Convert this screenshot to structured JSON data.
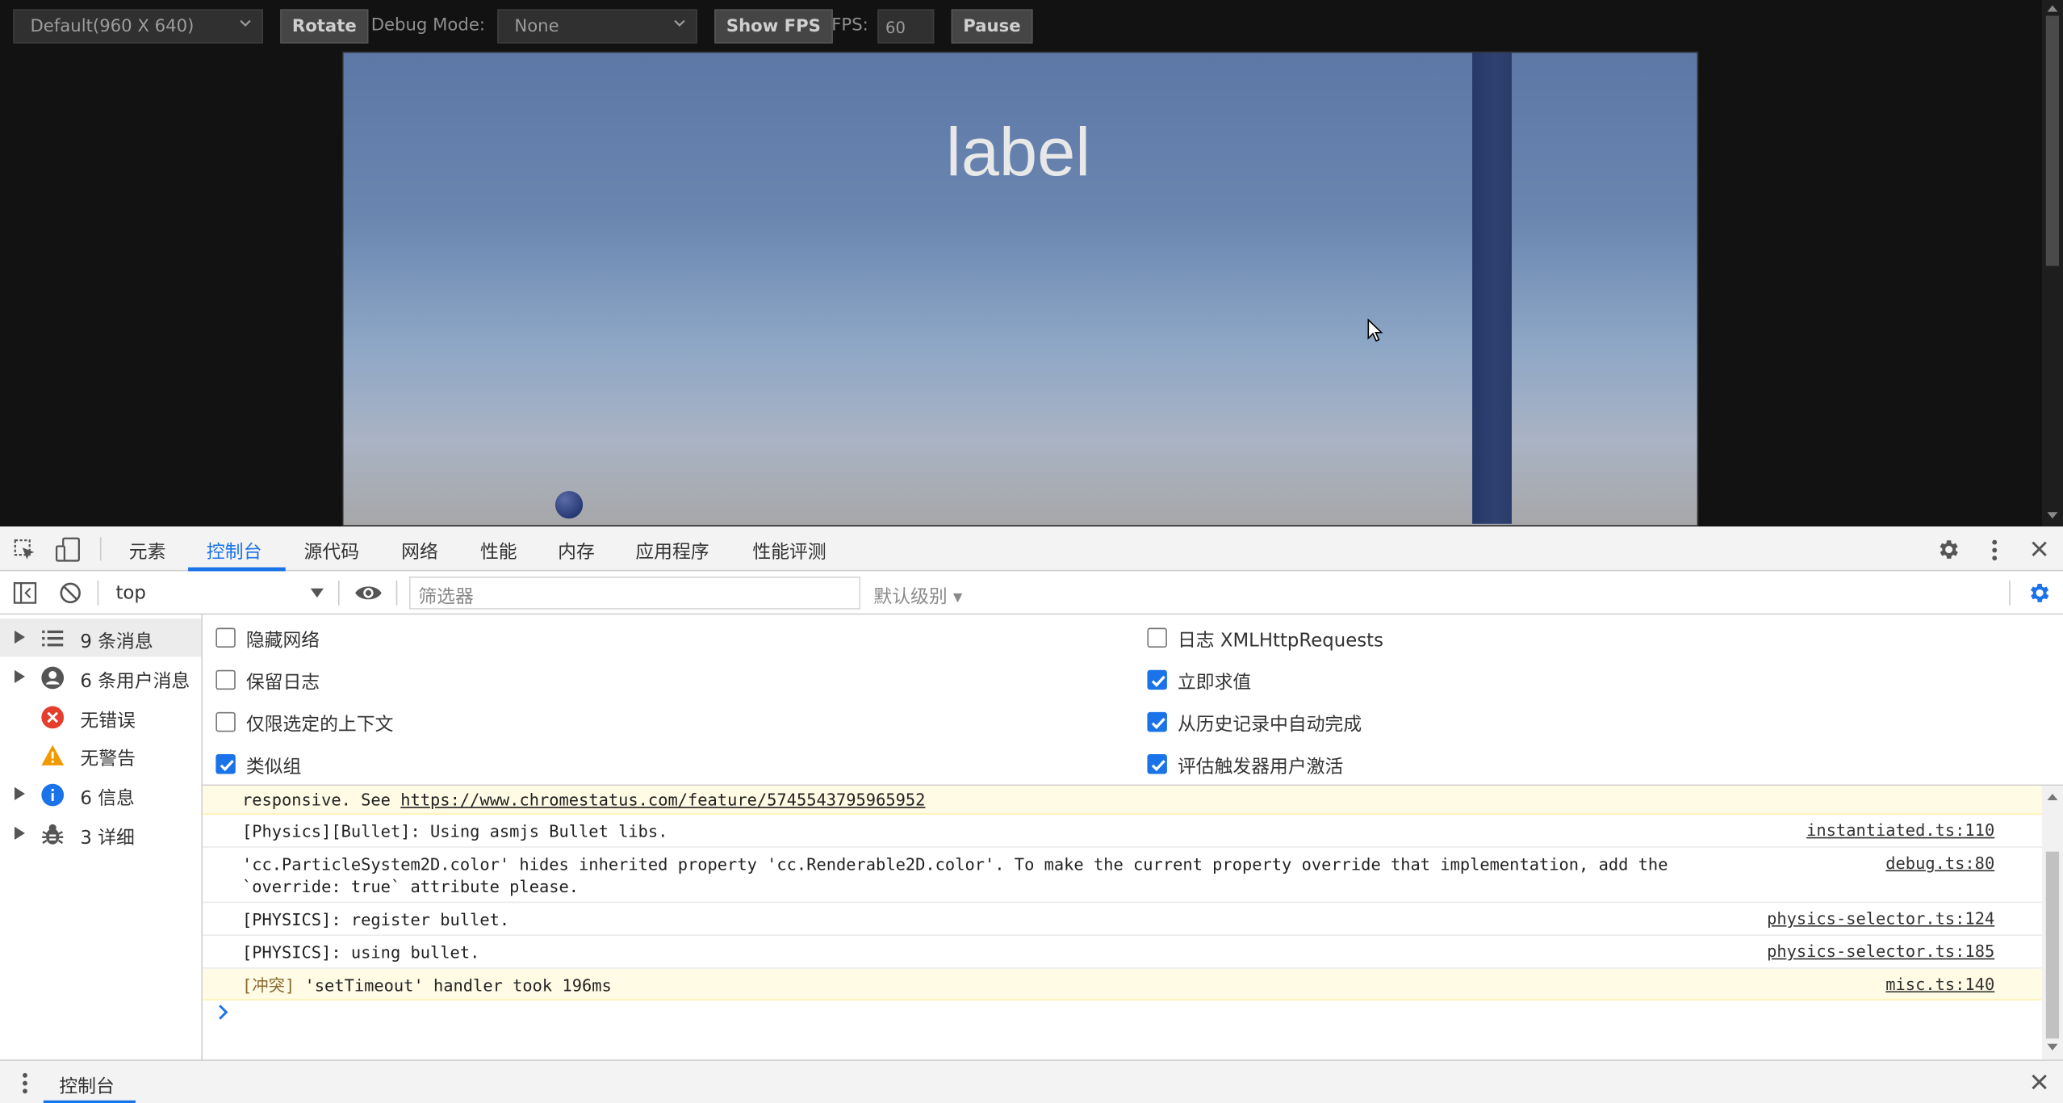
{
  "preview": {
    "device_select": "Default(960 X 640)",
    "rotate_label": "Rotate",
    "debug_mode_label": "Debug Mode:",
    "debug_mode_value": "None",
    "show_fps_label": "Show FPS",
    "fps_label": "FPS:",
    "fps_value": "60",
    "pause_label": "Pause",
    "game_label": "label"
  },
  "devtools": {
    "tabs": [
      "元素",
      "控制台",
      "源代码",
      "网络",
      "性能",
      "内存",
      "应用程序",
      "性能评测"
    ],
    "active_tab": "控制台",
    "context": "top",
    "filter_placeholder": "筛选器",
    "level": "默认级别",
    "sidebar": [
      {
        "label": "9 条消息",
        "icon": "list-icon"
      },
      {
        "label": "6 条用户消息",
        "icon": "user-icon"
      },
      {
        "label": "无错误",
        "icon": "error-icon"
      },
      {
        "label": "无警告",
        "icon": "warning-icon"
      },
      {
        "label": "6 信息",
        "icon": "info-icon"
      },
      {
        "label": "3 详细",
        "icon": "bug-icon"
      }
    ],
    "settings_left": [
      {
        "label": "隐藏网络",
        "checked": false
      },
      {
        "label": "保留日志",
        "checked": false
      },
      {
        "label": "仅限选定的上下文",
        "checked": false
      },
      {
        "label": "类似组",
        "checked": true
      }
    ],
    "settings_right": [
      {
        "label": "日志 XMLHttpRequests",
        "checked": false
      },
      {
        "label": "立即求值",
        "checked": true
      },
      {
        "label": "从历史记录中自动完成",
        "checked": true
      },
      {
        "label": "评估触发器用户激活",
        "checked": true
      }
    ],
    "log": [
      {
        "text_prefix": "responsive. See ",
        "link": "https://www.chromestatus.com/feature/5745543795965952",
        "source": "",
        "type": "warn"
      },
      {
        "text": "[Physics][Bullet]: Using asmjs Bullet libs.",
        "source": "instantiated.ts:110",
        "type": "log"
      },
      {
        "text": "'cc.ParticleSystem2D.color' hides inherited property 'cc.Renderable2D.color'. To make the current property override that implementation, add the",
        "text2": "`override: true` attribute please.",
        "source": "debug.ts:80",
        "type": "log"
      },
      {
        "text": "[PHYSICS]: register bullet.",
        "source": "physics-selector.ts:124",
        "type": "log"
      },
      {
        "text": "[PHYSICS]: using bullet.",
        "source": "physics-selector.ts:185",
        "type": "log"
      },
      {
        "tag": "[冲突]",
        "text": " 'setTimeout' handler took 196ms",
        "source": "misc.ts:140",
        "type": "warn"
      }
    ],
    "drawer_tab": "控制台"
  }
}
